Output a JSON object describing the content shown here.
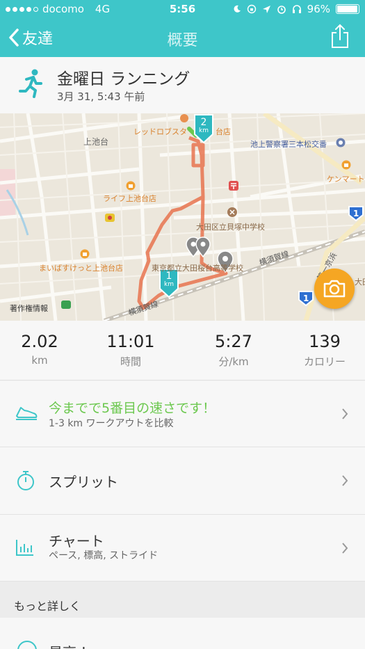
{
  "status_bar": {
    "carrier": "docomo",
    "network": "4G",
    "time": "5:56",
    "battery_percent": "96%",
    "battery_level": 0.96
  },
  "nav": {
    "back_label": "友達",
    "title": "概要"
  },
  "activity": {
    "title": "金曜日 ランニング",
    "date": "3月 31, 5:43 午前"
  },
  "map": {
    "labels": {
      "red_lobster": "レッドロブスタ",
      "red_lobster_tail": "台店",
      "kamiikedai": "上池台",
      "police": "池上警察署三本松交番",
      "kenmart": "ケンマート",
      "life": "ライフ上池台店",
      "school": "大田区立貝塚中学校",
      "maibasuket": "まいばすけっと上池台店",
      "school2": "東京都立大田桜台高等学校",
      "yokosuka": "横須賀線",
      "yokosuka2": "横須賀線",
      "chosaku": "著作権情報",
      "ichiban": "第一京浜",
      "ota": "大田"
    },
    "markers": [
      {
        "label": "2",
        "unit": "km"
      },
      {
        "label": "1",
        "unit": "km"
      }
    ],
    "route_shields": [
      "1",
      "1"
    ]
  },
  "stats": [
    {
      "value": "2.02",
      "unit": "km"
    },
    {
      "value": "11:01",
      "unit": "時間"
    },
    {
      "value": "5:27",
      "unit": "分/km"
    },
    {
      "value": "139",
      "unit": "カロリー"
    }
  ],
  "rows": {
    "compare": {
      "title": "今までで5番目の速さです！",
      "subtitle": "1-3 km ワークアウトを比較"
    },
    "splits": {
      "title": "スプリット"
    },
    "chart": {
      "title": "チャート",
      "subtitle": "ペース, 標高, ストライド"
    }
  },
  "more": {
    "title": "もっと詳しく",
    "next_row_title": "最高 !"
  },
  "colors": {
    "accent": "#3ec6c9",
    "route": "#e8734f",
    "highlight": "#6cc84f",
    "camera": "#f5a623"
  }
}
